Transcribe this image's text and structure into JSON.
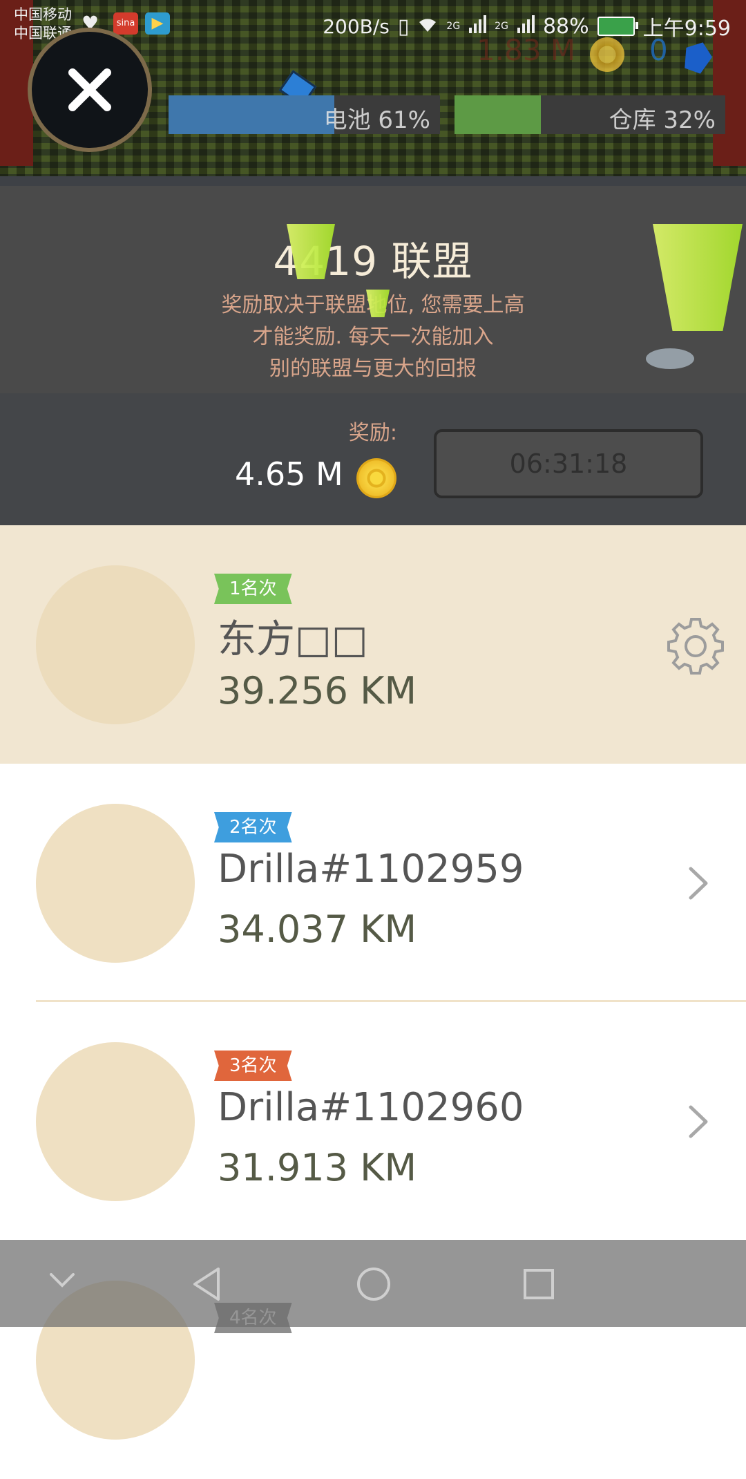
{
  "status_bar": {
    "carrier_1": "中国移动",
    "carrier_2": "中国联通",
    "sina_label": "sina",
    "speed": "200B/s",
    "net_1": "2G",
    "net_2": "2G",
    "battery": "88%",
    "time": "上午9:59"
  },
  "hud": {
    "money": "1.83 M",
    "gems": "0",
    "battery_label": "电池 61%",
    "battery_level": 0.61,
    "storage_label": "仓库 32%",
    "storage_level": 0.32
  },
  "league": {
    "title": "4419 联盟",
    "description": "奖励取决于联盟地位, 您需要上高\n才能奖励. 每天一次能加入\n别的联盟与更大的回报",
    "reward_label": "奖励:",
    "reward_amount": "4.65 M",
    "timer": "06:31:18"
  },
  "ranking": [
    {
      "rank": "1名次",
      "name": "东方□□",
      "distance": "39.256 KM",
      "action_icon": "gear-icon"
    },
    {
      "rank": "2名次",
      "name": "Drilla#1102959",
      "distance": "34.037 KM",
      "action_icon": "chevron-right-icon"
    },
    {
      "rank": "3名次",
      "name": "Drilla#1102960",
      "distance": "31.913 KM",
      "action_icon": "chevron-right-icon"
    },
    {
      "rank": "4名次",
      "name": "",
      "distance": "",
      "action_icon": ""
    }
  ],
  "colors": {
    "highlight_row": "#f1e6d1",
    "badge_1": "#79c35a",
    "badge_2": "#3e9ede",
    "badge_3": "#e0663c",
    "panel": "#4a4a4a",
    "description_text": "#d9a58b"
  },
  "navigation": {
    "icons": [
      "chevron-down-icon",
      "back-icon",
      "home-icon",
      "recents-icon"
    ]
  }
}
